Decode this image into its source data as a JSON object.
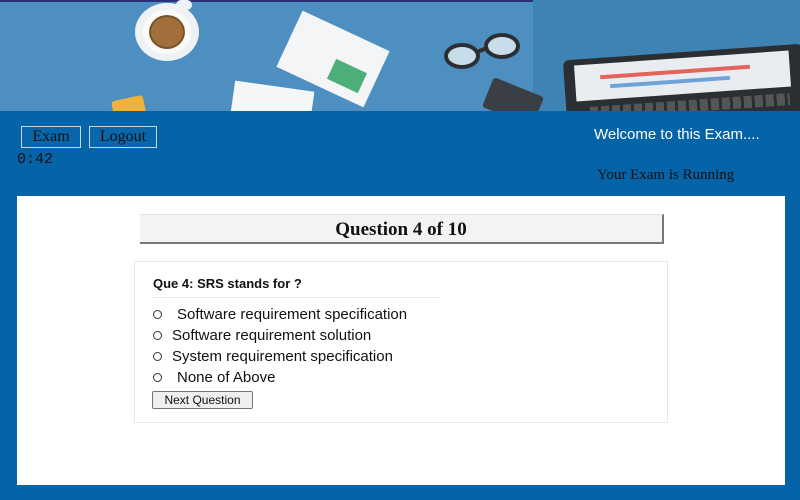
{
  "header": {
    "exam_button": "Exam",
    "logout_button": "Logout",
    "timer": "0:42",
    "welcome_text": "Welcome to this Exam....",
    "status_text": "Your Exam is Running"
  },
  "question": {
    "header": "Question 4 of 10",
    "text": "Que 4: SRS stands for ?",
    "options": [
      "Software requirement specification",
      "Software requirement solution",
      "System requirement specification",
      "None of Above"
    ],
    "next_button": "Next Question"
  },
  "colors": {
    "page_background": "#0563a8",
    "banner": "#4d8fc0",
    "panel": "#ffffff"
  }
}
